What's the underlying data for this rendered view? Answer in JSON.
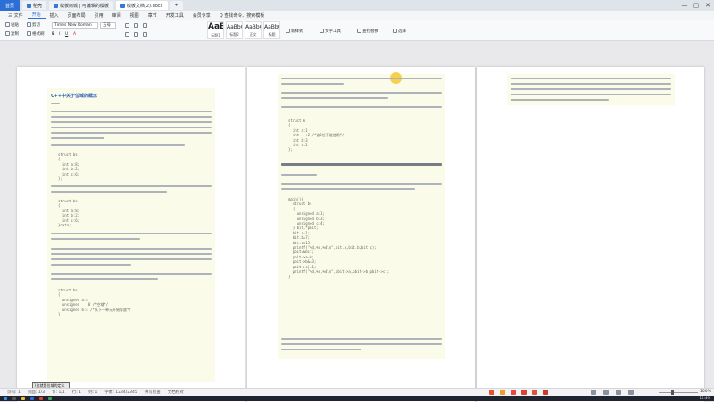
{
  "tabs": {
    "home": "首页",
    "tab1": "稻壳",
    "tab2": "模板商城 | 可编辑的模板",
    "tab3": "模板文档(2).docx",
    "new_tab": "+"
  },
  "window": {
    "minimize": "—",
    "maximize": "▢",
    "close": "✕"
  },
  "menu": [
    "三 文件",
    "开始",
    "插入",
    "页面布局",
    "引用",
    "审阅",
    "视图",
    "章节",
    "开发工具",
    "会员专享",
    "Q 查找命令、搜索模板"
  ],
  "menu_active_index": 1,
  "ribbon": {
    "paste": "粘贴",
    "cut": "剪切",
    "copy": "复制",
    "format_painter": "格式刷",
    "font_name": "Times New Roman",
    "font_size": "五号",
    "styles": [
      {
        "preview": "AaBbC",
        "label": "标题1"
      },
      {
        "preview": "AaBbC",
        "label": "标题2"
      },
      {
        "preview": "AaBbCcDd",
        "label": "正文"
      },
      {
        "preview": "AaBbCcDd",
        "label": "标题"
      }
    ],
    "new_style": "新样式",
    "text_tools": "文字工具",
    "find_replace": "查找替换",
    "select": "选择"
  },
  "page1": {
    "title": "C++中关于位域的概念",
    "code_a": "struct bs\n{\n  int a:8;\n  int b:2;\n  int c:6;\n};",
    "code_b": "struct bs\n{\n  int a:8;\n  int b:2;\n  int c:6;\n}data;",
    "code_c": "struct bs\n{\n  unsigned a:4\n  unsigned   :0 /*空域*/\n  unsigned b:4 /*从下一单元开始存放*/\n}",
    "selected_text": "}这就是位域的定义"
  },
  "page2": {
    "code_a": "struct k\n{\n  int a:1\n  int   :2 /*该2位不能使用*/\n  int b:3\n  int c:2\n};",
    "code_b": "main(){\n  struct bs\n  {\n    unsigned a:1;\n    unsigned b:3;\n    unsigned c:4;\n  } bit,*pbit;\n  bit.a=1;\n  bit.b=7;\n  bit.c=15;\n  printf(\"%d,%d,%d\\n\",bit.a,bit.b,bit.c);\n  pbit=&bit;\n  pbit->a=0;\n  pbit->b&=3;\n  pbit->c|=1;\n  printf(\"%d,%d,%d\\n\",pbit->a,pbit->b,pbit->c);\n}"
  },
  "status": {
    "page": "页码: 1",
    "pages": "页面: 1/3",
    "section": "节: 1/1",
    "row": "行: 1",
    "col": "列: 1",
    "words": "字数: 1234/2345",
    "spell": "拼写检查",
    "doc_check": "文档校对",
    "zoom": "100%"
  },
  "taskbar": {
    "time": "15:49"
  },
  "colors": {
    "accent": "#2c6fd6",
    "highlight": "#fbfbe9",
    "cursor": "#f5c832"
  }
}
